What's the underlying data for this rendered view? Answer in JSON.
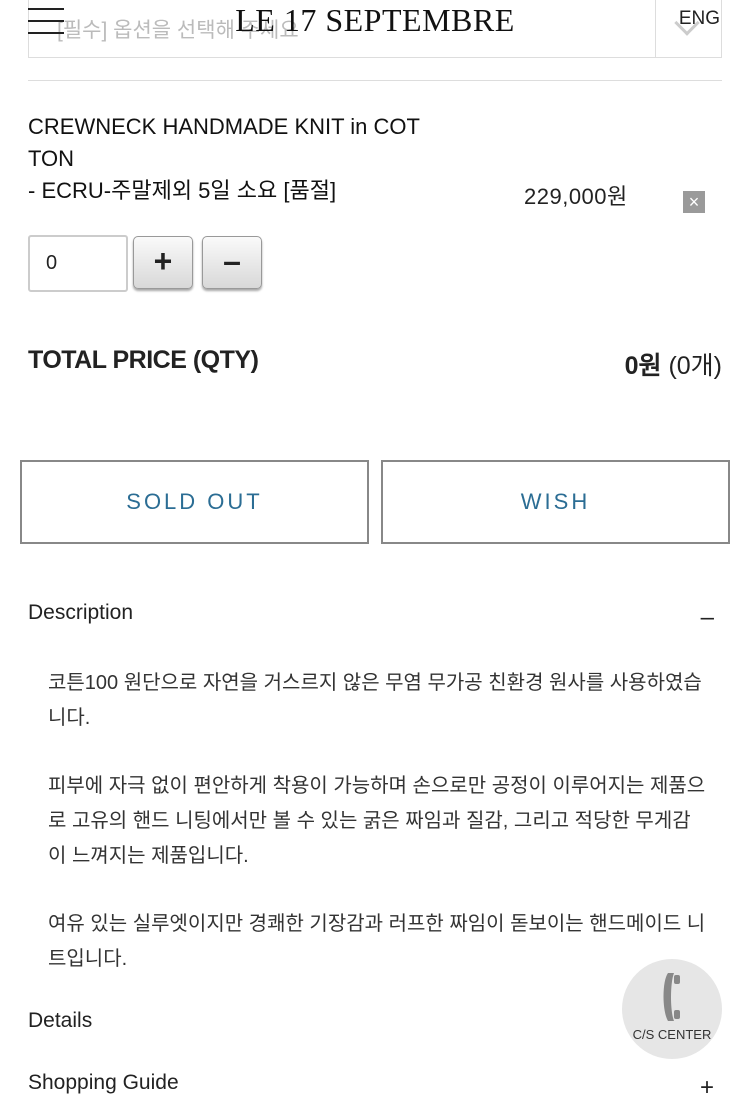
{
  "header": {
    "brand": "LE 17 SEPTEMBRE",
    "lang": "ENG"
  },
  "option_select": {
    "placeholder": "[필수] 옵션을 선택해 주세요"
  },
  "product": {
    "name_line1": "CREWNECK HANDMADE KNIT in COT",
    "name_line2": "TON",
    "name_line3": "- ECRU-주말제외 5일 소요 [품절]",
    "price": "229,000원",
    "remove_icon": "×",
    "quantity": "0",
    "plus": "+",
    "minus": "–"
  },
  "total": {
    "label": "TOTAL PRICE (QTY)",
    "amount": "0원",
    "qty": "(0개)"
  },
  "actions": {
    "sold_out": "SOLD OUT",
    "wish": "WISH"
  },
  "description": {
    "title": "Description",
    "toggle": "–",
    "paragraphs": [
      "코튼100 원단으로 자연을 거스르지 않은 무염 무가공 친환경 원사를 사용하였습니다.",
      "피부에 자극 없이 편안하게 착용이 가능하며 손으로만 공정이 이루어지는 제품으로 고유의 핸드 니팅에서만 볼 수 있는 굵은 짜임과 질감, 그리고 적당한 무게감이 느껴지는 제품입니다.",
      "여유 있는 실루엣이지만 경쾌한 기장감과 러프한 짜임이 돋보이는 핸드메이드 니트입니다."
    ]
  },
  "details": {
    "title": "Details"
  },
  "shopping_guide": {
    "title": "Shopping Guide",
    "toggle": "+"
  },
  "cs_center": {
    "label": "C/S CENTER"
  }
}
